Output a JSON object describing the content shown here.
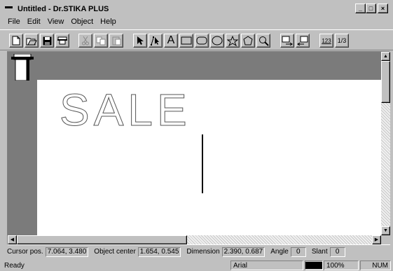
{
  "window": {
    "title": "Untitled - Dr.STIKA PLUS"
  },
  "caption_buttons": {
    "minimize": "_",
    "maximize": "□",
    "close": "×"
  },
  "menu": [
    {
      "label": "File"
    },
    {
      "label": "Edit"
    },
    {
      "label": "View"
    },
    {
      "label": "Object"
    },
    {
      "label": "Help"
    }
  ],
  "toolbar": {
    "tools": [
      {
        "icon": "new-document-icon"
      },
      {
        "icon": "open-folder-icon"
      },
      {
        "icon": "save-disk-icon"
      },
      {
        "icon": "plotter-icon"
      },
      {
        "icon": "cut-icon",
        "disabled": true
      },
      {
        "icon": "copy-icon",
        "disabled": true
      },
      {
        "icon": "paste-icon",
        "disabled": true
      },
      {
        "icon": "select-arrow-icon"
      },
      {
        "icon": "node-edit-icon"
      },
      {
        "icon": "text-tool-icon",
        "label": "A"
      },
      {
        "icon": "rectangle-icon"
      },
      {
        "icon": "rounded-rectangle-icon"
      },
      {
        "icon": "ellipse-icon"
      },
      {
        "icon": "star-icon"
      },
      {
        "icon": "polygon-icon"
      },
      {
        "icon": "zoom-icon"
      },
      {
        "icon": "import-icon"
      },
      {
        "icon": "export-icon"
      },
      {
        "icon": "numbering-icon",
        "label": "123"
      },
      {
        "icon": "fraction-icon",
        "label": "1/3"
      }
    ]
  },
  "canvas": {
    "text": "SALE"
  },
  "info": {
    "cursor_label": "Cursor pos.",
    "cursor_value": "7.064, 3.480",
    "center_label": "Object center",
    "center_value": "1.654, 0.545",
    "dimension_label": "Dimension",
    "dimension_value": "2.390, 0.687",
    "angle_label": "Angle",
    "angle_value": "0",
    "slant_label": "Slant",
    "slant_value": "0"
  },
  "status": {
    "message": "Ready",
    "font": "Arial",
    "zoom": "100%",
    "numlock": "NUM",
    "fill_color": "#000000"
  }
}
